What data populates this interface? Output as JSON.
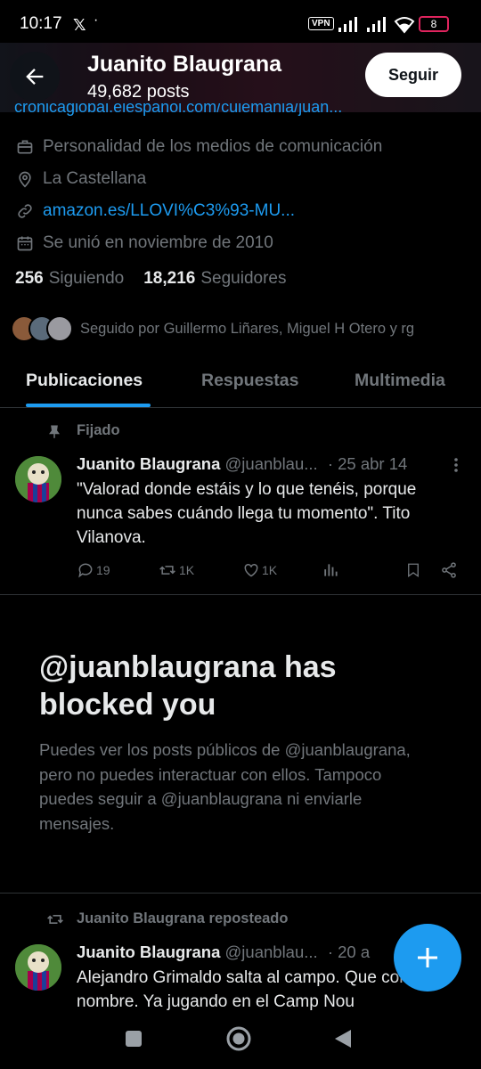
{
  "status_bar": {
    "time": "10:17",
    "x_logo": "𝕏",
    "dot": "·",
    "vpn": "VPN",
    "battery": "8"
  },
  "header": {
    "name": "Juanito Blaugrana",
    "posts_count": "49,682 posts",
    "follow_label": "Seguir"
  },
  "bio": {
    "link_line": "cronicaglobal.elespanol.com/culemania/juan...",
    "category": "Personalidad de los medios de comunicación",
    "location": "La Castellana",
    "website": "amazon.es/LLOVI%C3%93-MU...",
    "joined": "Se unió en noviembre de 2010"
  },
  "stats": {
    "following_count": "256",
    "following_label": "Siguiendo",
    "followers_count": "18,216",
    "followers_label": "Seguidores"
  },
  "followed_by": "Seguido por Guillermo Liñares, Miguel H Otero y rg",
  "tabs": [
    {
      "label": "Publicaciones",
      "active": true
    },
    {
      "label": "Respuestas",
      "active": false
    },
    {
      "label": "Multimedia",
      "active": false
    }
  ],
  "pinned_tweet": {
    "pinned_label": "Fijado",
    "name": "Juanito Blaugrana",
    "handle": "@juanblau...",
    "date": "· 25 abr 14",
    "text": "\"Valorad donde estáis y lo que tenéis, porque nunca sabes cuándo llega tu momento\". Tito Vilanova.",
    "replies": "19",
    "reposts": "1K",
    "likes": "1K"
  },
  "blocked": {
    "title": "@juanblaugrana has blocked you",
    "body": "Puedes ver los posts públicos de @juanblaugrana, pero no puedes interactuar con ellos. Tampoco puedes seguir a @juanblaugrana ni enviarle mensajes."
  },
  "repost_tweet": {
    "repost_label": "Juanito Blaugrana reposteado",
    "name": "Juanito Blaugrana",
    "handle": "@juanblau...",
    "date": "· 20 a",
    "text": "Alejandro Grimaldo salta al campo. Que con este nombre. Ya jugando en el Camp Nou"
  },
  "colors": {
    "accent": "#1d9bf0",
    "muted": "#71767b",
    "background": "#000000",
    "text": "#e7e9ea"
  },
  "icons": [
    "back-arrow-icon",
    "briefcase-icon",
    "location-pin-icon",
    "link-icon",
    "calendar-icon",
    "pin-icon",
    "more-icon",
    "reply-icon",
    "repost-icon",
    "like-icon",
    "views-icon",
    "bookmark-icon",
    "share-icon",
    "plus-icon"
  ]
}
